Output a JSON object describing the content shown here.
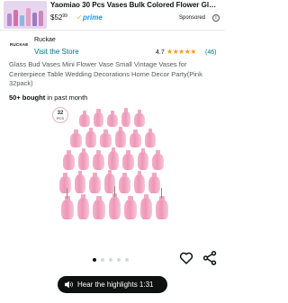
{
  "sponsored": {
    "title": "Yaomiao 30 Pcs Vases Bulk Colored Flower Gl…",
    "price_whole": "$52",
    "price_fraction": "99",
    "prime_label": "prime",
    "sponsored_label": "Sponsored",
    "info_symbol": "i"
  },
  "brand": {
    "logo_text": "RUCKAE",
    "name": "Ruckae",
    "store_link": "Visit the Store"
  },
  "rating": {
    "value": "4.7",
    "stars": 4.7,
    "count": "(46)"
  },
  "product": {
    "title": "Glass Bud Vases Mini Flower Vase Small Vintage Vases for Centerpiece Table Wedding Decorations Home Decor Party(Pink 32pack)",
    "bought_bold": "50+ bought",
    "bought_rest": " in past month",
    "image_badge_top": "32",
    "image_badge_bottom": "PCS"
  },
  "carousel": {
    "total": 5,
    "active_index": 0
  },
  "highlights": {
    "label": "Hear the highlights 1:31"
  },
  "colors": {
    "link": "#007185",
    "star": "#f59e0b",
    "prime": "#1a98ff",
    "vase_pink": "#ec8fb1"
  },
  "icons": [
    "info-icon",
    "star-icon",
    "heart-icon",
    "share-icon",
    "speaker-icon",
    "checkmark-icon"
  ]
}
